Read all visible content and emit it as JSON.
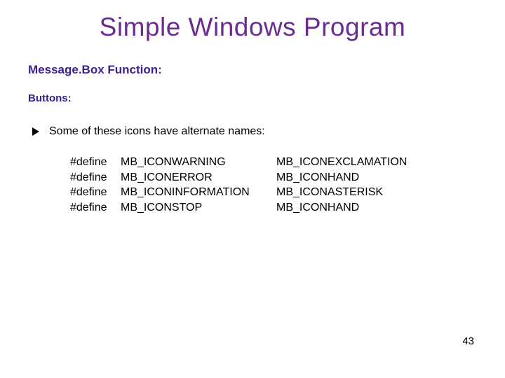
{
  "title": "Simple Windows Program",
  "subtitle": "Message.Box Function:",
  "section_label": "Buttons:",
  "bullet_text": "Some of these icons have alternate names:",
  "defines": [
    {
      "keyword": "#define",
      "col1": "MB_ICONWARNING",
      "col2": "MB_ICONEXCLAMATION"
    },
    {
      "keyword": "#define",
      "col1": "MB_ICONERROR",
      "col2": "MB_ICONHAND"
    },
    {
      "keyword": "#define",
      "col1": "MB_ICONINFORMATION",
      "col2": "MB_ICONASTERISK"
    },
    {
      "keyword": "#define",
      "col1": "MB_ICONSTOP",
      "col2": "MB_ICONHAND"
    }
  ],
  "page_number": "43"
}
